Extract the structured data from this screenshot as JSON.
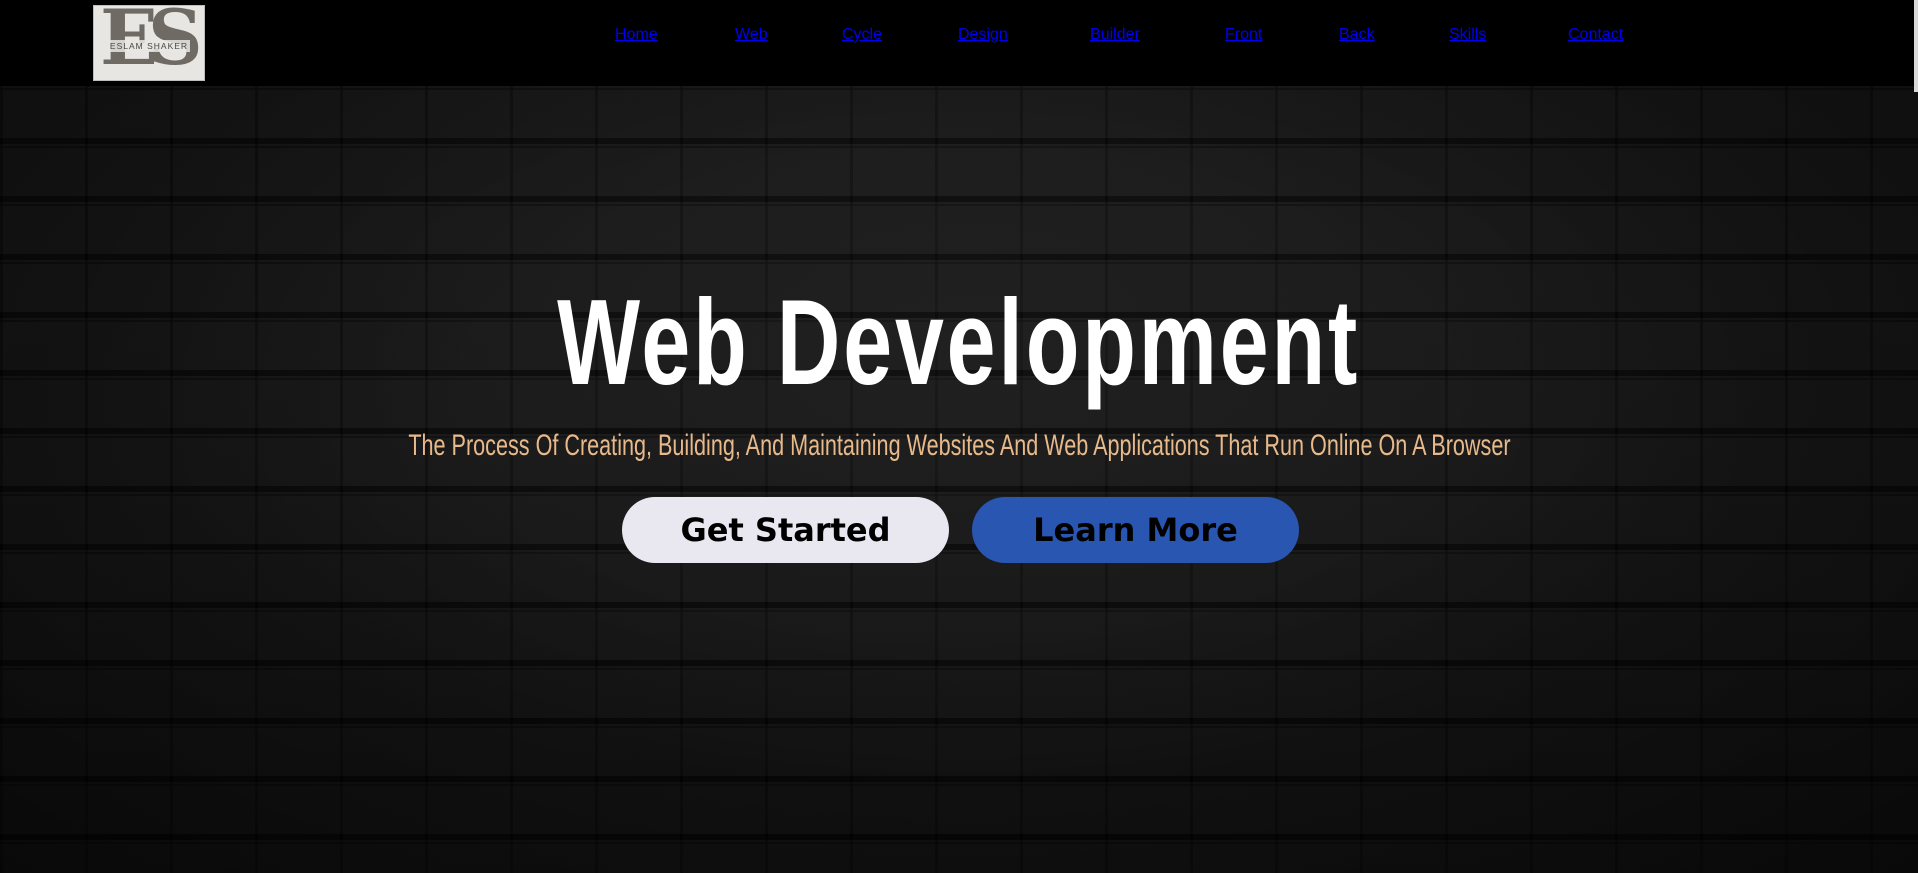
{
  "header": {
    "logo": {
      "letters": "ES",
      "name": "ESLAM SHAKER"
    },
    "nav": [
      {
        "label": "Home"
      },
      {
        "label": "Web"
      },
      {
        "label": "Cycle"
      },
      {
        "label": "Design"
      },
      {
        "label": "Builder"
      },
      {
        "label": "Front"
      },
      {
        "label": "Back"
      },
      {
        "label": "Skills"
      },
      {
        "label": "Contact"
      }
    ]
  },
  "hero": {
    "title": "Web Development",
    "subtitle": "The Process Of Creating, Building, And Maintaining Websites And Web Applications That Run Online On A Browser",
    "primary_button": "Get Started",
    "secondary_button": "Learn More"
  },
  "colors": {
    "header_bg": "#000000",
    "subtitle": "#e8b98a",
    "primary_button_bg": "#e9e7ef",
    "secondary_button_bg": "#2956b0"
  }
}
